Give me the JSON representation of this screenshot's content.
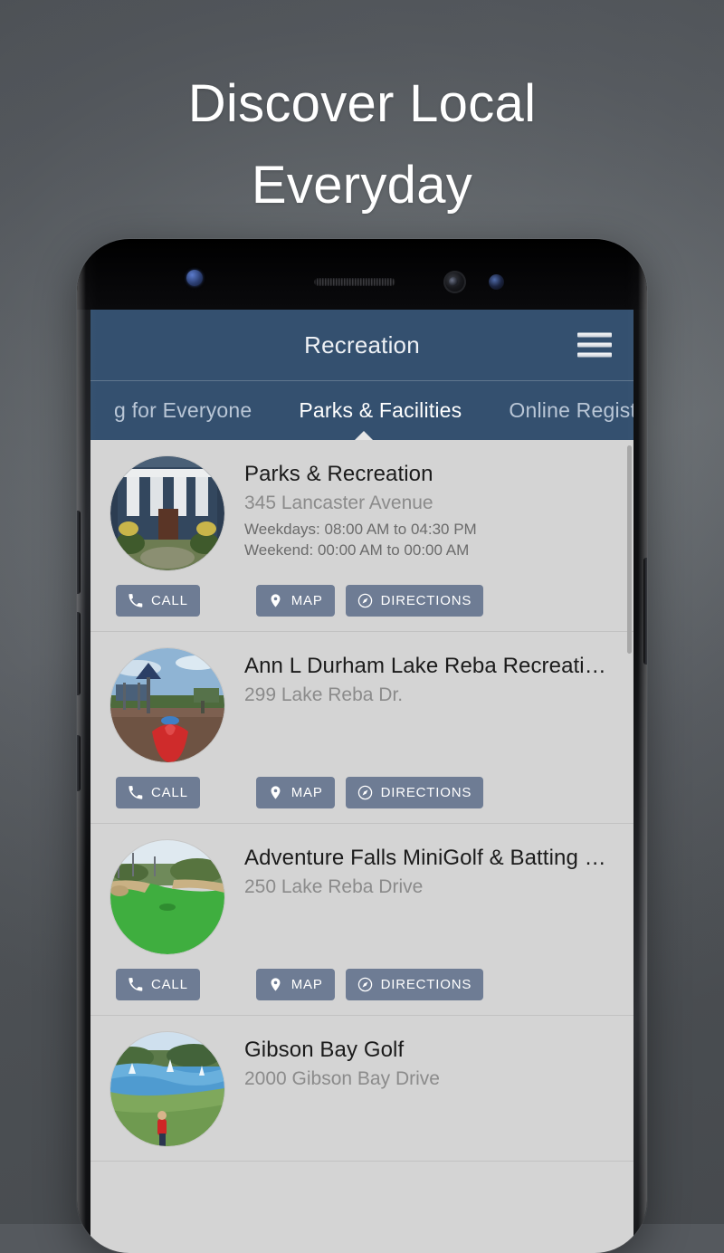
{
  "promo": {
    "headline_line1": "Discover Local",
    "headline_line2": "Everyday"
  },
  "colors": {
    "appbar": "#34506f",
    "content_bg": "#d4d4d4",
    "button": "#6e7c94",
    "title_text": "#1b1b1b",
    "address_text": "#8b8b8b",
    "backdrop_dark": "#4f5357",
    "backdrop_light": "#7b8085"
  },
  "app": {
    "title": "Recreation",
    "menu_icon": "hamburger-icon",
    "tabs": [
      {
        "label": "g for Everyone",
        "active": false
      },
      {
        "label": "Parks & Facilities",
        "active": true
      },
      {
        "label": "Online Registra",
        "active": false
      }
    ],
    "buttons": {
      "call": {
        "label": "CALL",
        "icon": "phone-icon"
      },
      "map": {
        "label": "MAP",
        "icon": "map-pin-icon"
      },
      "directions": {
        "label": "DIRECTIONS",
        "icon": "compass-icon"
      }
    },
    "listings": [
      {
        "name": "Parks & Recreation",
        "address": "345 Lancaster Avenue",
        "hours": [
          "Weekdays:  08:00 AM to 04:30 PM",
          "Weekend:  00:00 AM to 00:00 AM"
        ],
        "thumbnail": "historic-building-photo"
      },
      {
        "name": "Ann L Durham Lake Reba Recreational...",
        "address": "299 Lake Reba Dr.",
        "hours": [],
        "thumbnail": "playground-photo"
      },
      {
        "name": "Adventure Falls MiniGolf & Batting Cag...",
        "address": "250 Lake Reba Drive",
        "hours": [],
        "thumbnail": "minigolf-course-photo"
      },
      {
        "name": "Gibson Bay Golf",
        "address": "2000 Gibson Bay Drive",
        "hours": [],
        "thumbnail": "golf-course-lake-photo"
      }
    ]
  }
}
